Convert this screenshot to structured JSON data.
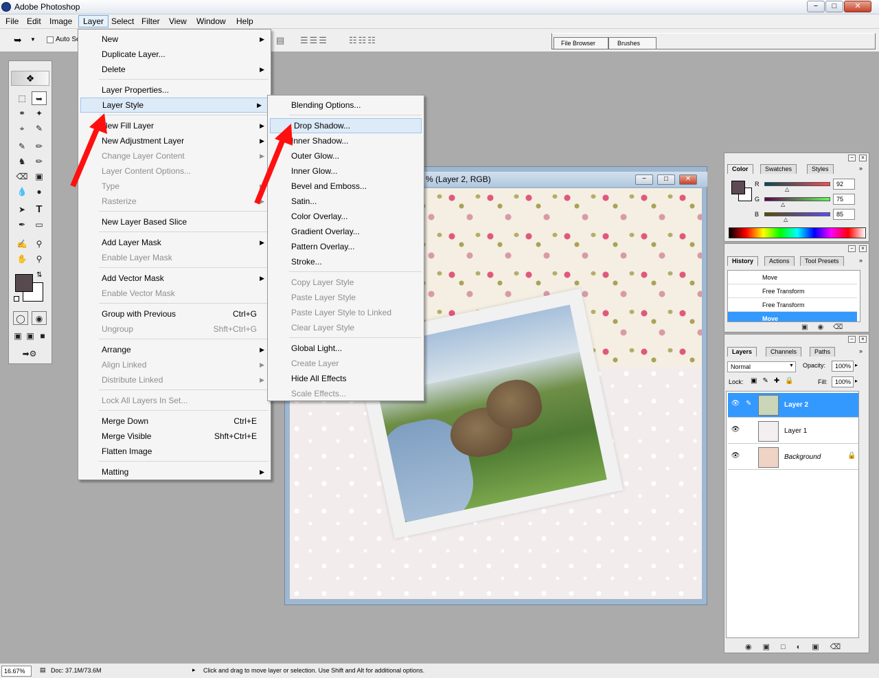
{
  "app_title": "Adobe Photoshop",
  "window_buttons": [
    "−",
    "□",
    "✕"
  ],
  "menubar": [
    "File",
    "Edit",
    "Image",
    "Layer",
    "Select",
    "Filter",
    "View",
    "Window",
    "Help"
  ],
  "options": {
    "auto_select_label": "Auto Se"
  },
  "palette_well": {
    "tabs": [
      "File Browser",
      "Brushes"
    ]
  },
  "layer_menu": {
    "items": [
      {
        "label": "New",
        "arrow": true
      },
      {
        "label": "Duplicate Layer..."
      },
      {
        "label": "Delete",
        "arrow": true
      },
      {
        "sep": true
      },
      {
        "label": "Layer Properties..."
      },
      {
        "label": "Layer Style",
        "arrow": true,
        "highlight": true
      },
      {
        "sep": true
      },
      {
        "label": "New Fill Layer",
        "arrow": true
      },
      {
        "label": "New Adjustment Layer",
        "arrow": true
      },
      {
        "label": "Change Layer Content",
        "arrow": true,
        "disabled": true
      },
      {
        "label": "Layer Content Options...",
        "disabled": true
      },
      {
        "label": "Type",
        "arrow": true,
        "disabled": true
      },
      {
        "label": "Rasterize",
        "arrow": true,
        "disabled": true
      },
      {
        "sep": true
      },
      {
        "label": "New Layer Based Slice"
      },
      {
        "sep": true
      },
      {
        "label": "Add Layer Mask",
        "arrow": true
      },
      {
        "label": "Enable Layer Mask",
        "disabled": true
      },
      {
        "sep": true
      },
      {
        "label": "Add Vector Mask",
        "arrow": true
      },
      {
        "label": "Enable Vector Mask",
        "disabled": true
      },
      {
        "sep": true
      },
      {
        "label": "Group with Previous",
        "shortcut": "Ctrl+G"
      },
      {
        "label": "Ungroup",
        "shortcut": "Shft+Ctrl+G",
        "disabled": true
      },
      {
        "sep": true
      },
      {
        "label": "Arrange",
        "arrow": true
      },
      {
        "label": "Align Linked",
        "arrow": true,
        "disabled": true
      },
      {
        "label": "Distribute Linked",
        "arrow": true,
        "disabled": true
      },
      {
        "sep": true
      },
      {
        "label": "Lock All Layers In Set...",
        "disabled": true
      },
      {
        "sep": true
      },
      {
        "label": "Merge Down",
        "shortcut": "Ctrl+E"
      },
      {
        "label": "Merge Visible",
        "shortcut": "Shft+Ctrl+E"
      },
      {
        "label": "Flatten Image"
      },
      {
        "sep": true
      },
      {
        "label": "Matting",
        "arrow": true
      }
    ]
  },
  "layer_style_menu": {
    "items": [
      {
        "label": "Blending Options..."
      },
      {
        "sep": true
      },
      {
        "label": "Drop Shadow...",
        "highlight": true
      },
      {
        "label": "Inner Shadow..."
      },
      {
        "label": "Outer Glow..."
      },
      {
        "label": "Inner Glow..."
      },
      {
        "label": "Bevel and Emboss..."
      },
      {
        "label": "Satin..."
      },
      {
        "label": "Color Overlay..."
      },
      {
        "label": "Gradient Overlay..."
      },
      {
        "label": "Pattern Overlay..."
      },
      {
        "label": "Stroke..."
      },
      {
        "sep": true
      },
      {
        "label": "Copy Layer Style",
        "disabled": true
      },
      {
        "label": "Paste Layer Style",
        "disabled": true
      },
      {
        "label": "Paste Layer Style to Linked",
        "disabled": true
      },
      {
        "label": "Clear Layer Style",
        "disabled": true
      },
      {
        "sep": true
      },
      {
        "label": "Global Light..."
      },
      {
        "label": "Create Layer",
        "disabled": true
      },
      {
        "label": "Hide All Effects"
      },
      {
        "label": "Scale Effects...",
        "disabled": true
      }
    ]
  },
  "document": {
    "title": "% (Layer 2, RGB)"
  },
  "color_palette": {
    "tabs": [
      "Color",
      "Swatches",
      "Styles"
    ],
    "channels": [
      {
        "label": "R",
        "value": "92"
      },
      {
        "label": "G",
        "value": "75"
      },
      {
        "label": "B",
        "value": "85"
      }
    ],
    "foreground": "#5c4b55"
  },
  "history_palette": {
    "tabs": [
      "History",
      "Actions",
      "Tool Presets"
    ],
    "items": [
      "Move",
      "Free Transform",
      "Free Transform",
      "Move"
    ]
  },
  "layers_palette": {
    "tabs": [
      "Layers",
      "Channels",
      "Paths"
    ],
    "blend_mode": "Normal",
    "opacity_label": "Opacity:",
    "opacity": "100%",
    "lock_label": "Lock:",
    "fill_label": "Fill:",
    "fill": "100%",
    "layers": [
      {
        "name": "Layer 2",
        "selected": true
      },
      {
        "name": "Layer 1"
      },
      {
        "name": "Background",
        "italic": true,
        "locked": true
      }
    ]
  },
  "statusbar": {
    "zoom": "16.67%",
    "doc": "Doc: 37.1M/73.6M",
    "hint": "Click and drag to move layer or selection.  Use Shift and Alt for additional options."
  },
  "colors": {
    "highlight": "#3399ff",
    "arrow": "#ff1010"
  }
}
